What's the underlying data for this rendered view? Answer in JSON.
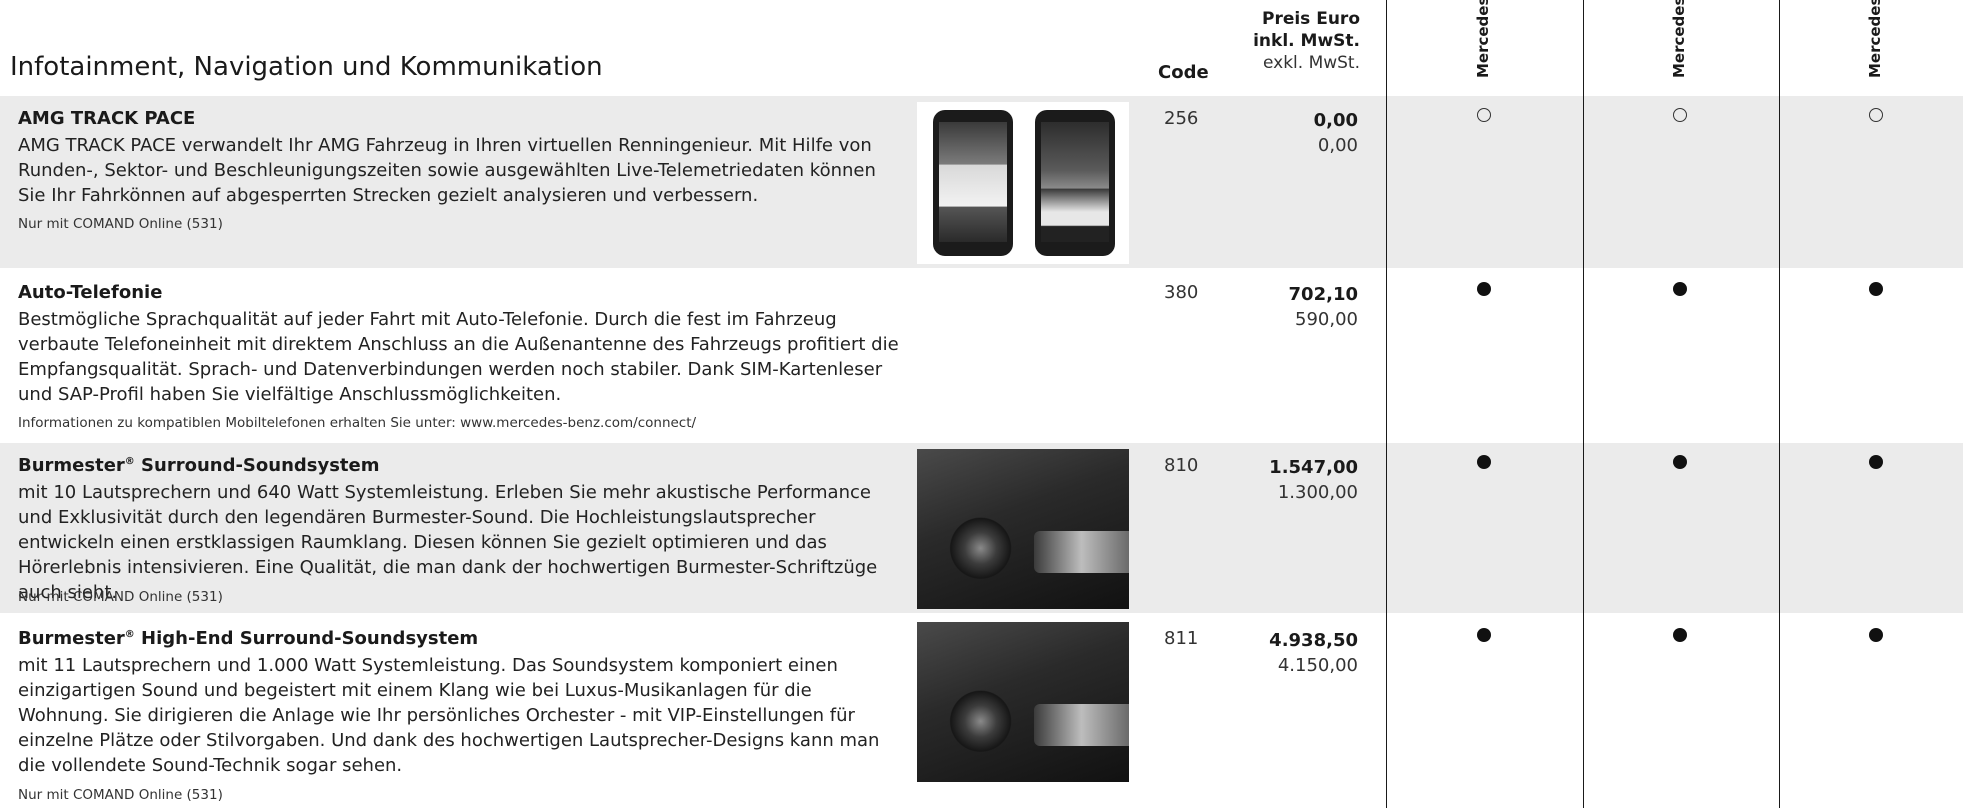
{
  "section": {
    "title": "Infotainment, Navigation und Kommunikation"
  },
  "header": {
    "code_label": "Code",
    "price_label_line1": "Preis Euro",
    "price_label_line2": "inkl. MwSt.",
    "price_label_line3": "exkl. MwSt.",
    "models": [
      "Mercedes",
      "Mercedes",
      "Mercedes"
    ]
  },
  "marks": {
    "standard": "●",
    "optional": "○"
  },
  "colors": {
    "row_background": "#ebebeb",
    "text": "#1a1a1a"
  },
  "rows": [
    {
      "title": "AMG TRACK PACE",
      "description": "AMG TRACK PACE verwandelt Ihr AMG Fahrzeug in Ihren virtuellen Renningenieur. Mit Hilfe von Runden-, Sektor- und Beschleunigungszeiten sowie ausgewählten Live-Telemetriedaten können Sie Ihr Fahrkönnen auf abgesperrten Strecken gezielt analysieren und verbessern.",
      "note": "Nur mit COMAND Online (531)",
      "code": "256",
      "price_gross": "0,00",
      "price_net": "0,00",
      "availability": [
        "optional",
        "optional",
        "optional"
      ],
      "image": "smartphone-app-screens"
    },
    {
      "title": "Auto-Telefonie",
      "description": "Bestmögliche Sprachqualität auf jeder Fahrt mit Auto-Telefonie. Durch die fest im Fahrzeug verbaute Telefoneinheit mit direktem Anschluss an die Außenantenne des Fahrzeugs profitiert die Empfangsqualität. Sprach- und Datenverbindungen werden noch stabiler. Dank SIM-Kartenleser und SAP-Profil haben Sie vielfältige Anschlussmöglichkeiten.",
      "note": "Informationen zu kompatiblen Mobiltelefonen erhalten Sie unter: www.mercedes-benz.com/connect/",
      "code": "380",
      "price_gross": "702,10",
      "price_net": "590,00",
      "availability": [
        "standard",
        "standard",
        "standard"
      ]
    },
    {
      "title": "Burmester",
      "title_sup": "®",
      "title_rest": " Surround-Soundsystem",
      "description": "mit 10 Lautsprechern und 640 Watt Systemleistung. Erleben Sie mehr akustische Performance und Exklusivität durch den legendären Burmester-Sound. Die Hochleistungslautsprecher entwickeln einen erstklassigen Raumklang. Diesen können Sie gezielt optimieren und das Hörerlebnis intensivieren. Eine Qualität, die man dank der hochwertigen Burmester-Schriftzüge auch sieht.",
      "note": "Nur mit COMAND Online (531)",
      "code": "810",
      "price_gross": "1.547,00",
      "price_net": "1.300,00",
      "availability": [
        "standard",
        "standard",
        "standard"
      ],
      "image": "door-speaker-photo"
    },
    {
      "title": "Burmester",
      "title_sup": "®",
      "title_rest": " High-End Surround-Soundsystem",
      "description": "mit 11 Lautsprechern und 1.000 Watt Systemleistung. Das Soundsystem komponiert einen einzigartigen Sound und begeistert mit einem Klang wie bei Luxus-Musikanlagen für die Wohnung. Sie dirigieren die Anlage wie Ihr persönliches Orchester - mit VIP-Einstellungen für einzelne Plätze oder Stilvorgaben. Und dank des hochwertigen Lautsprecher-Designs kann man die vollendete Sound-Technik sogar sehen.",
      "note": "Nur mit COMAND Online (531)",
      "code": "811",
      "price_gross": "4.938,50",
      "price_net": "4.150,00",
      "availability": [
        "standard",
        "standard",
        "standard"
      ],
      "image": "door-speaker-photo"
    }
  ]
}
